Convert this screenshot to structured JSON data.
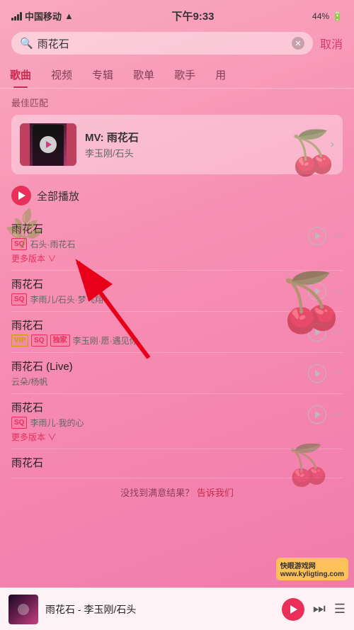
{
  "status": {
    "carrier": "中国移动",
    "time": "下午9:33",
    "battery": "44%"
  },
  "search": {
    "query": "雨花石",
    "cancel_label": "取消"
  },
  "tabs": [
    {
      "id": "songs",
      "label": "歌曲",
      "active": true
    },
    {
      "id": "videos",
      "label": "视频",
      "active": false
    },
    {
      "id": "albums",
      "label": "专辑",
      "active": false
    },
    {
      "id": "playlists",
      "label": "歌单",
      "active": false
    },
    {
      "id": "artists",
      "label": "歌手",
      "active": false
    },
    {
      "id": "more",
      "label": "用",
      "active": false
    }
  ],
  "best_match": {
    "section_title": "最佳匹配",
    "type_label": "MV: 雨花石",
    "subtitle": "李玉刚/石头"
  },
  "play_all": {
    "label": "全部播放"
  },
  "songs": [
    {
      "title": "雨花石",
      "badges": [
        "SQ"
      ],
      "artist": "石头·雨花石",
      "has_more_version": true,
      "more_version_label": "更多版本",
      "more_version_icon": "∨"
    },
    {
      "title": "雨花石",
      "badges": [
        "SQ"
      ],
      "artist": "李雨儿/石头·梦飞翔",
      "has_more_version": false
    },
    {
      "title": "雨花石",
      "badges": [
        "VIP",
        "SQ",
        "独家"
      ],
      "artist": "李玉刚·愿·遇见你",
      "has_more_version": false
    },
    {
      "title": "雨花石 (Live)",
      "badges": [],
      "artist": "云朵/杨帆",
      "has_more_version": false
    },
    {
      "title": "雨花石",
      "badges": [
        "SQ"
      ],
      "artist": "李雨儿·我的心",
      "has_more_version": true,
      "more_version_label": "更多版本",
      "more_version_icon": "∨"
    }
  ],
  "partial_title": "雨花石",
  "not_found": {
    "text": "没找到满意结果？",
    "link": "告诉我们"
  },
  "bottom_player": {
    "title": "雨花石 - 李玉刚/石头",
    "subtitle": "",
    "prev_icon": "⏮",
    "next_icon": "⏭",
    "list_icon": "☰"
  },
  "watermark": {
    "site": "快眼游戏网",
    "url": "www.kyligting.com"
  }
}
